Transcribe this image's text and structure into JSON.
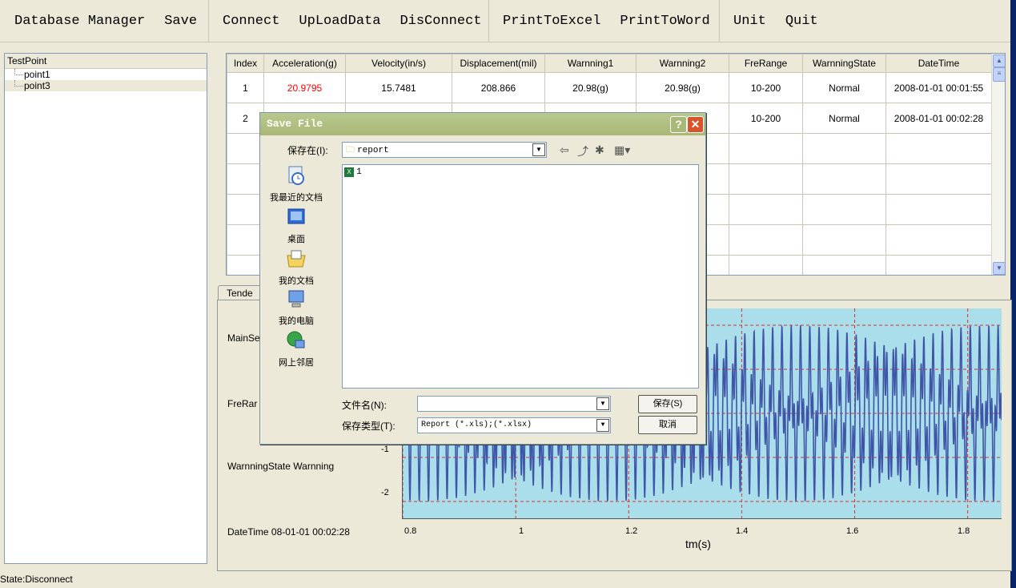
{
  "menu": {
    "group1": [
      "Database Manager",
      "Save"
    ],
    "group2": [
      "Connect",
      "UpLoadData",
      "DisConnect"
    ],
    "group3": [
      "PrintToExcel",
      "PrintToWord"
    ],
    "group4": [
      "Unit",
      "Quit"
    ]
  },
  "tree": {
    "header": "TestPoint",
    "nodes": [
      "point1",
      "point3"
    ]
  },
  "grid": {
    "columns": [
      "Index",
      "Acceleration(g)",
      "Velocity(in/s)",
      "Displacement(mil)",
      "Warnning1",
      "Warnning2",
      "FreRange",
      "WarnningState",
      "DateTime"
    ],
    "rows": [
      [
        "1",
        "20.9795",
        "15.7481",
        "208.866",
        "20.98(g)",
        "20.98(g)",
        "10-200",
        "Normal",
        "2008-01-01 00:01:55"
      ],
      [
        "2",
        "",
        "",
        "",
        "",
        "",
        "10-200",
        "Normal",
        "2008-01-01 00:02:28"
      ]
    ]
  },
  "panel": {
    "tab": "Tende",
    "main": "MainSe",
    "frerange": "FreRar",
    "state": "WarnningState  Warnning",
    "datetime": "DateTime  08-01-01 00:02:28"
  },
  "chart_data": {
    "type": "line",
    "x_ticks": [
      "0.8",
      "1",
      "1.2",
      "1.4",
      "1.6",
      "1.8"
    ],
    "y_ticks": [
      "-1",
      "-2"
    ],
    "xlabel": "tm(s)",
    "xlim": [
      0.8,
      1.86
    ],
    "series": [
      {
        "values_description": "dense periodic oscillation between about -2 and +2"
      }
    ]
  },
  "status": "State:Disconnect",
  "dialog": {
    "title": "Save File",
    "save_in_label": "保存在(I):",
    "folder": "report",
    "places": [
      "我最近的文档",
      "桌面",
      "我的文档",
      "我的电脑",
      "网上邻居"
    ],
    "files": [
      "1"
    ],
    "filename_label": "文件名(N):",
    "filename_value": "",
    "filetype_label": "保存类型(T):",
    "filetype_value": "Report (*.xls);(*.xlsx)",
    "save_button": "保存(S)",
    "cancel_button": "取消",
    "help": "?",
    "close": "✕"
  },
  "colors": {
    "accent_red": "#ff0000",
    "plot_bg": "#aadeea",
    "signal": "#3f55a8"
  }
}
